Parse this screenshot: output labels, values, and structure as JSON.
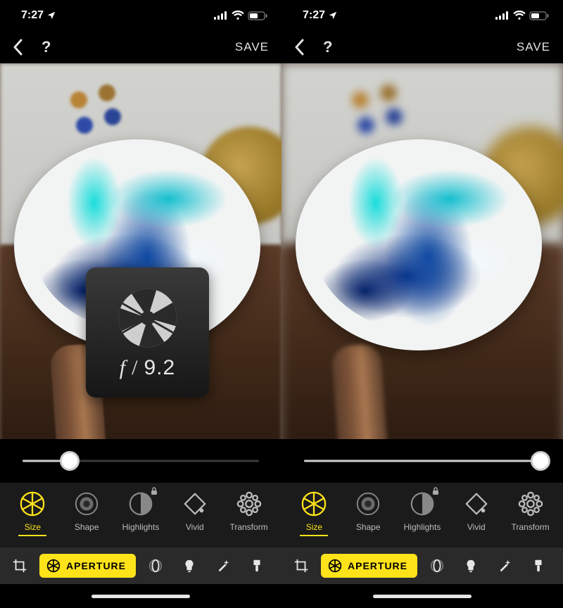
{
  "status": {
    "time": "7:27",
    "location_arrow": true
  },
  "nav": {
    "save_label": "SAVE"
  },
  "overlay": {
    "prefix": "f",
    "divider": "/",
    "value": "9.2"
  },
  "slider": {
    "left": {
      "value_percent": 20
    },
    "right": {
      "value_percent": 100
    }
  },
  "tools": [
    {
      "id": "size",
      "label": "Size",
      "active": true,
      "locked": false
    },
    {
      "id": "shape",
      "label": "Shape",
      "active": false,
      "locked": false
    },
    {
      "id": "highlights",
      "label": "Highlights",
      "active": false,
      "locked": true
    },
    {
      "id": "vivid",
      "label": "Vivid",
      "active": false,
      "locked": false
    },
    {
      "id": "transform",
      "label": "Transform",
      "active": false,
      "locked": false
    }
  ],
  "bottom": {
    "aperture_label": "APERTURE",
    "icons": [
      "crop-icon",
      "lens-icon",
      "bulb-icon",
      "wand-icon",
      "brush-icon"
    ]
  },
  "colors": {
    "accent": "#ffe31a",
    "bg_tools": "#1b1b1b",
    "bg_bottom": "#2a2a2a"
  }
}
